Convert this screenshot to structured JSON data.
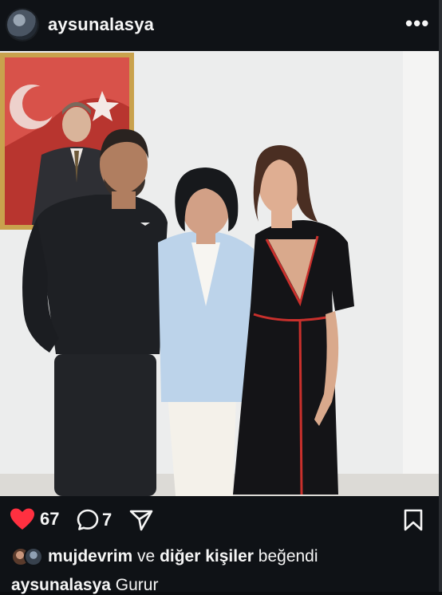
{
  "post": {
    "username": "aysunalasya",
    "more_label": "•••",
    "likes_count": "67",
    "comments_count": "7",
    "liked_by": {
      "user": "mujdevrim",
      "connector": " ve ",
      "others": "diğer kişiler",
      "suffix": " beğendi"
    },
    "caption": {
      "username": "aysunalasya",
      "text": "Gurur"
    }
  },
  "colors": {
    "heart": "#ff3040",
    "text": "#f5f5f5",
    "background": "#0f1216"
  },
  "icons": {
    "like": "heart-icon",
    "comment": "comment-icon",
    "share": "send-icon",
    "save": "bookmark-icon",
    "more": "more-icon"
  }
}
